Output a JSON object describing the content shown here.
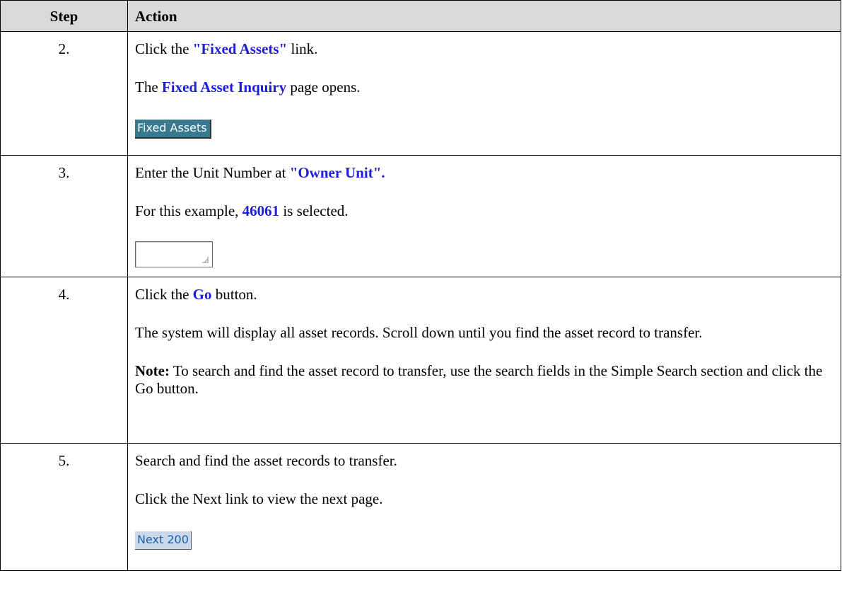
{
  "header": {
    "step": "Step",
    "action": "Action"
  },
  "rows": [
    {
      "step": "2.",
      "p1": {
        "pre": "Click the ",
        "hl": "\"Fixed Assets\"",
        "post": " link."
      },
      "p2": {
        "pre": "The ",
        "hl": "Fixed Asset Inquiry",
        "post": " page opens."
      },
      "control": {
        "label": "Fixed Assets",
        "color": "#377a8f"
      }
    },
    {
      "step": "3.",
      "p1": {
        "pre": "Enter the Unit Number at ",
        "hl": "\"Owner Unit\"."
      },
      "p2": {
        "pre": "For this example, ",
        "hl": "46061",
        "post": " is selected."
      },
      "control": {
        "value": "",
        "icon": "resize-grip-icon"
      }
    },
    {
      "step": "4.",
      "p1": {
        "pre": "Click the ",
        "hl": "Go",
        "post": " button."
      },
      "p2": {
        "text": "The system will display all asset records. Scroll down until you find the asset record to transfer."
      },
      "p3": {
        "bold": "Note:",
        "text": " To search and find the asset record to transfer, use the search fields in the Simple Search section and click the Go button."
      }
    },
    {
      "step": "5.",
      "p1": {
        "text": "Search and find the asset records to transfer."
      },
      "p2": {
        "text": "Click the Next link to view the next page."
      },
      "control": {
        "label": "Next 200",
        "color": "#c9d8ea"
      }
    }
  ],
  "colors": {
    "highlight": "#1d1ddc",
    "header_bg": "#d9d9d9"
  }
}
